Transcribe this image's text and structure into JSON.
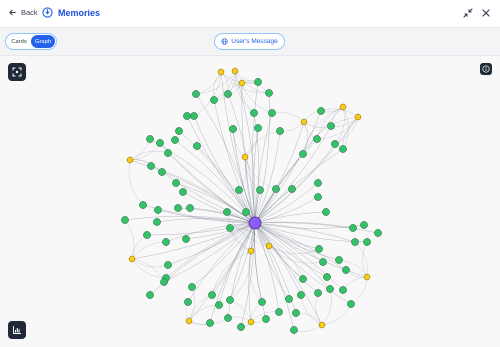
{
  "header": {
    "back_label": "Back",
    "title": "Memories",
    "title_icon": "memory-icon",
    "collapse_icon": "collapse-icon",
    "close_icon": "close-icon"
  },
  "toolbar": {
    "view_options": [
      "Cards",
      "Graph"
    ],
    "selected_view": "Graph",
    "cards_label": "Cards",
    "graph_label": "Graph",
    "user_message_label": "User's Message",
    "user_message_icon": "globe-icon"
  },
  "graph": {
    "center_color": "#8b5cf6",
    "hub_color": "#facc15",
    "leaf_color": "#34c16a",
    "edge_color": "#6b7280",
    "node_count": 100
  },
  "controls": {
    "fit_icon": "fit-view-icon",
    "info_icon": "info-icon",
    "stats_icon": "bar-chart-icon"
  },
  "colors": {
    "accent": "#2563eb",
    "title": "#1d4ed8",
    "dark_button": "#1f2937"
  }
}
